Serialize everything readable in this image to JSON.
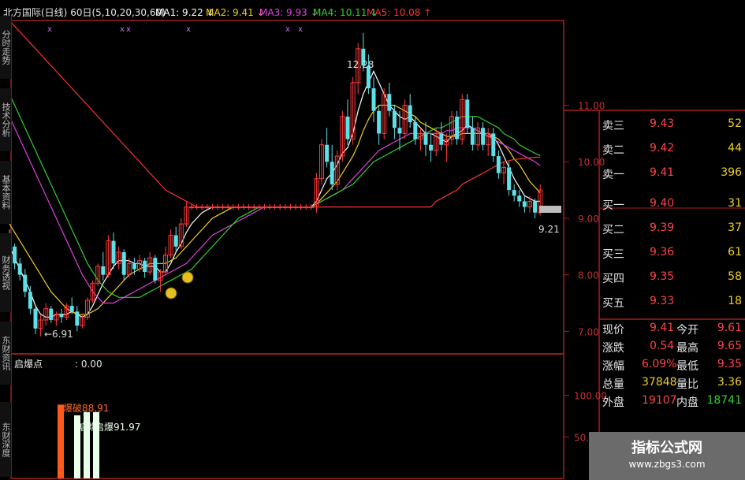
{
  "header": {
    "title": "北方国际(日线)",
    "period": "60日",
    "ma_params": "(5,10,20,30,60)",
    "ma": [
      {
        "label": "MA1:",
        "value": "9.22",
        "arrow": "↓",
        "color": "#ffffff"
      },
      {
        "label": "MA2:",
        "value": "9.41",
        "arrow": "↓",
        "color": "#f0d020"
      },
      {
        "label": "MA3:",
        "value": "9.93",
        "arrow": "↓",
        "color": "#e040e0"
      },
      {
        "label": "MA4:",
        "value": "10.11",
        "arrow": "↓",
        "color": "#30d030"
      },
      {
        "label": "MA5:",
        "value": "10.08",
        "arrow": "↑",
        "color": "#ff3030"
      }
    ],
    "marks": "x"
  },
  "side_tabs": [
    "分时走势",
    "技术分析",
    "基本资料",
    "财务透视",
    "东财资讯",
    "东财深度"
  ],
  "price_chart": {
    "y_ticks": [
      "11.00",
      "10.00",
      "9.00",
      "8.00",
      "7.00"
    ],
    "low_label": "←6.91",
    "high_label": "12.28",
    "last_label": "9.21",
    "colors": {
      "up": "#ff3b3b",
      "down": "#5ee0e8"
    }
  },
  "indicator": {
    "name": "启爆点",
    "value": ": 0.00",
    "y_ticks": [
      "100.00",
      "50.00"
    ],
    "labels": [
      "爆破88.91",
      "启爆",
      "启爆91.97"
    ],
    "bars": [
      {
        "value": 88.91,
        "color": "#ff5a1a"
      },
      {
        "value": 76,
        "color": "#e8ffe8"
      },
      {
        "value": 80,
        "color": "#e8ffe8"
      },
      {
        "value": 80,
        "color": "#e8ffe8"
      }
    ]
  },
  "order_book": [
    {
      "name": "卖三",
      "price": "9.43",
      "vol": "52",
      "pcolor": "#ff4444",
      "vcolor": "#f0d020"
    },
    {
      "name": "卖二",
      "price": "9.42",
      "vol": "44",
      "pcolor": "#ff4444",
      "vcolor": "#f0d020"
    },
    {
      "name": "卖一",
      "price": "9.41",
      "vol": "396",
      "pcolor": "#ff4444",
      "vcolor": "#f0d020"
    },
    {
      "name": "买一",
      "price": "9.40",
      "vol": "31",
      "pcolor": "#ff4444",
      "vcolor": "#f0d020"
    },
    {
      "name": "买二",
      "price": "9.39",
      "vol": "37",
      "pcolor": "#ff4444",
      "vcolor": "#f0d020"
    },
    {
      "name": "买三",
      "price": "9.36",
      "vol": "61",
      "pcolor": "#ff4444",
      "vcolor": "#f0d020"
    },
    {
      "name": "买四",
      "price": "9.35",
      "vol": "58",
      "pcolor": "#ff4444",
      "vcolor": "#f0d020"
    },
    {
      "name": "买五",
      "price": "9.33",
      "vol": "18",
      "pcolor": "#ff4444",
      "vcolor": "#f0d020"
    }
  ],
  "stats": [
    {
      "n1": "现价",
      "v1": "9.41",
      "c1": "#ff4444",
      "n2": "今开",
      "v2": "9.61",
      "c2": "#ff4444"
    },
    {
      "n1": "涨跌",
      "v1": "0.54",
      "c1": "#ff4444",
      "n2": "最高",
      "v2": "9.65",
      "c2": "#ff4444"
    },
    {
      "n1": "涨幅",
      "v1": "6.09%",
      "c1": "#ff4444",
      "n2": "最低",
      "v2": "9.35",
      "c2": "#ff4444"
    },
    {
      "n1": "总量",
      "v1": "37848",
      "c1": "#f0d020",
      "n2": "量比",
      "v2": "3.36",
      "c2": "#f0d020"
    },
    {
      "n1": "外盘",
      "v1": "19107",
      "c1": "#ff4444",
      "n2": "内盘",
      "v2": "18741",
      "c2": "#30d030"
    }
  ],
  "watermark": {
    "title": "指标公式网",
    "url": "www.zbgs3.com"
  },
  "chart_data": {
    "type": "candlestick",
    "title": "北方国际(日线)",
    "ylim": [
      6.6,
      12.5
    ],
    "ohlc": [
      [
        8.7,
        8.8,
        8.4,
        8.5
      ],
      [
        8.5,
        8.55,
        8.1,
        8.2
      ],
      [
        8.2,
        8.3,
        7.9,
        8.0
      ],
      [
        8.0,
        8.1,
        7.6,
        7.7
      ],
      [
        7.7,
        7.8,
        7.3,
        7.4
      ],
      [
        7.4,
        7.45,
        6.95,
        7.05
      ],
      [
        7.05,
        7.3,
        6.91,
        7.2
      ],
      [
        7.2,
        7.5,
        7.1,
        7.4
      ],
      [
        7.4,
        7.45,
        7.15,
        7.2
      ],
      [
        7.2,
        7.35,
        7.1,
        7.3
      ],
      [
        7.3,
        7.4,
        7.15,
        7.25
      ],
      [
        7.25,
        7.5,
        7.2,
        7.45
      ],
      [
        7.45,
        7.6,
        7.3,
        7.35
      ],
      [
        7.35,
        7.45,
        7.0,
        7.1
      ],
      [
        7.1,
        7.3,
        7.05,
        7.25
      ],
      [
        7.25,
        7.6,
        7.2,
        7.55
      ],
      [
        7.55,
        7.9,
        7.5,
        7.85
      ],
      [
        7.85,
        8.2,
        7.8,
        8.15
      ],
      [
        8.15,
        8.4,
        7.9,
        8.0
      ],
      [
        8.0,
        8.7,
        7.95,
        8.6
      ],
      [
        8.6,
        8.75,
        8.1,
        8.2
      ],
      [
        8.2,
        8.5,
        8.1,
        8.4
      ],
      [
        8.4,
        8.45,
        7.9,
        8.0
      ],
      [
        8.0,
        8.3,
        7.95,
        8.2
      ],
      [
        8.2,
        8.3,
        8.0,
        8.1
      ],
      [
        8.1,
        8.35,
        8.05,
        8.25
      ],
      [
        8.25,
        8.3,
        7.95,
        8.05
      ],
      [
        8.05,
        8.4,
        8.0,
        8.3
      ],
      [
        8.3,
        8.35,
        7.85,
        7.9
      ],
      [
        7.9,
        8.1,
        7.7,
        8.05
      ],
      [
        8.05,
        8.5,
        8.0,
        8.35
      ],
      [
        8.35,
        8.8,
        8.3,
        8.7
      ],
      [
        8.7,
        8.85,
        8.4,
        8.5
      ],
      [
        8.5,
        9.0,
        8.45,
        8.9
      ],
      [
        8.9,
        9.3,
        8.85,
        9.2
      ],
      [
        9.2,
        9.25,
        9.15,
        9.2
      ],
      [
        9.2,
        9.25,
        9.15,
        9.2
      ],
      [
        9.2,
        9.25,
        9.15,
        9.2
      ],
      [
        9.2,
        9.25,
        9.15,
        9.2
      ],
      [
        9.2,
        9.25,
        9.15,
        9.2
      ],
      [
        9.2,
        9.25,
        9.15,
        9.2
      ],
      [
        9.2,
        9.25,
        9.15,
        9.2
      ],
      [
        9.2,
        9.25,
        9.15,
        9.2
      ],
      [
        9.2,
        9.25,
        9.15,
        9.2
      ],
      [
        9.2,
        9.25,
        9.15,
        9.2
      ],
      [
        9.2,
        9.25,
        9.15,
        9.2
      ],
      [
        9.2,
        9.25,
        9.15,
        9.2
      ],
      [
        9.2,
        9.25,
        9.15,
        9.2
      ],
      [
        9.2,
        9.25,
        9.15,
        9.2
      ],
      [
        9.2,
        9.25,
        9.15,
        9.2
      ],
      [
        9.2,
        9.25,
        9.15,
        9.2
      ],
      [
        9.2,
        9.25,
        9.15,
        9.2
      ],
      [
        9.2,
        9.25,
        9.15,
        9.2
      ],
      [
        9.2,
        9.25,
        9.15,
        9.2
      ],
      [
        9.2,
        9.25,
        9.15,
        9.2
      ],
      [
        9.2,
        9.25,
        9.15,
        9.2
      ],
      [
        9.2,
        9.25,
        9.15,
        9.2
      ],
      [
        9.2,
        9.25,
        9.15,
        9.2
      ],
      [
        9.2,
        9.25,
        9.15,
        9.2
      ],
      [
        9.2,
        9.8,
        9.1,
        9.7
      ],
      [
        9.7,
        10.4,
        9.6,
        10.3
      ],
      [
        10.3,
        10.6,
        9.9,
        10.0
      ],
      [
        10.0,
        10.3,
        9.5,
        9.6
      ],
      [
        9.6,
        10.2,
        9.5,
        10.1
      ],
      [
        10.1,
        10.9,
        10.0,
        10.8
      ],
      [
        10.8,
        11.1,
        10.3,
        10.4
      ],
      [
        10.4,
        11.5,
        10.3,
        11.4
      ],
      [
        11.4,
        12.1,
        11.2,
        12.0
      ],
      [
        12.0,
        12.28,
        11.6,
        11.7
      ],
      [
        11.7,
        11.9,
        11.2,
        11.3
      ],
      [
        11.3,
        11.5,
        10.7,
        10.9
      ],
      [
        10.9,
        11.0,
        10.3,
        10.5
      ],
      [
        10.5,
        11.3,
        10.4,
        11.2
      ],
      [
        11.2,
        11.4,
        10.8,
        10.9
      ],
      [
        10.9,
        11.0,
        10.4,
        10.6
      ],
      [
        10.6,
        10.9,
        10.2,
        10.5
      ],
      [
        10.5,
        11.1,
        10.4,
        11.0
      ],
      [
        11.0,
        11.2,
        10.6,
        10.7
      ],
      [
        10.7,
        10.8,
        10.3,
        10.4
      ],
      [
        10.4,
        10.6,
        10.2,
        10.5
      ],
      [
        10.5,
        10.7,
        10.1,
        10.3
      ],
      [
        10.3,
        10.5,
        10.0,
        10.2
      ],
      [
        10.2,
        10.6,
        10.1,
        10.5
      ],
      [
        10.5,
        10.7,
        10.2,
        10.3
      ],
      [
        10.3,
        10.5,
        10.0,
        10.4
      ],
      [
        10.4,
        10.9,
        10.3,
        10.8
      ],
      [
        10.8,
        10.9,
        10.3,
        10.4
      ],
      [
        10.4,
        11.2,
        10.3,
        11.1
      ],
      [
        11.1,
        11.2,
        10.5,
        10.6
      ],
      [
        10.6,
        10.8,
        10.2,
        10.3
      ],
      [
        10.3,
        10.7,
        10.2,
        10.6
      ],
      [
        10.6,
        10.7,
        10.2,
        10.3
      ],
      [
        10.3,
        10.6,
        10.1,
        10.5
      ],
      [
        10.5,
        10.6,
        10.0,
        10.1
      ],
      [
        10.1,
        10.2,
        9.7,
        9.8
      ],
      [
        9.8,
        10.0,
        9.6,
        9.9
      ],
      [
        9.9,
        10.0,
        9.4,
        9.5
      ],
      [
        9.5,
        9.6,
        9.3,
        9.4
      ],
      [
        9.4,
        9.5,
        9.2,
        9.3
      ],
      [
        9.3,
        9.4,
        9.1,
        9.2
      ],
      [
        9.2,
        9.4,
        9.1,
        9.3
      ],
      [
        9.3,
        9.35,
        9.0,
        9.1
      ],
      [
        9.1,
        9.6,
        9.05,
        9.5
      ]
    ],
    "series": [
      {
        "name": "MA1",
        "values": [
          8.5,
          8.3,
          8.1,
          7.9,
          7.7,
          7.45,
          7.3,
          7.25,
          7.25,
          7.3,
          7.3,
          7.3,
          7.35,
          7.3,
          7.25,
          7.3,
          7.45,
          7.65,
          7.85,
          8.0,
          8.15,
          8.25,
          8.25,
          8.25,
          8.2,
          8.2,
          8.15,
          8.15,
          8.15,
          8.05,
          8.05,
          8.2,
          8.4,
          8.55,
          8.75,
          8.9,
          9.0,
          9.1,
          9.15,
          9.2,
          9.2,
          9.2,
          9.2,
          9.2,
          9.2,
          9.2,
          9.2,
          9.2,
          9.2,
          9.2,
          9.2,
          9.2,
          9.2,
          9.2,
          9.2,
          9.2,
          9.2,
          9.2,
          9.2,
          9.3,
          9.5,
          9.7,
          9.8,
          9.95,
          10.15,
          10.25,
          10.5,
          10.9,
          11.2,
          11.4,
          11.6,
          11.4,
          11.2,
          11.0,
          10.9,
          10.8,
          10.75,
          10.8,
          10.7,
          10.6,
          10.5,
          10.5,
          10.45,
          10.4,
          10.35,
          10.45,
          10.5,
          10.55,
          10.65,
          10.6,
          10.55,
          10.5,
          10.45,
          10.45,
          10.3,
          10.1,
          9.9,
          9.7,
          9.55,
          9.4,
          9.35,
          9.3,
          9.3
        ]
      },
      {
        "name": "MA2",
        "values": [
          8.9,
          8.75,
          8.6,
          8.45,
          8.3,
          8.15,
          8.0,
          7.85,
          7.7,
          7.6,
          7.5,
          7.4,
          7.35,
          7.3,
          7.3,
          7.3,
          7.35,
          7.4,
          7.5,
          7.6,
          7.7,
          7.8,
          7.9,
          8.0,
          8.05,
          8.1,
          8.15,
          8.2,
          8.2,
          8.2,
          8.2,
          8.25,
          8.3,
          8.4,
          8.5,
          8.6,
          8.7,
          8.8,
          8.9,
          9.0,
          9.05,
          9.1,
          9.15,
          9.2,
          9.2,
          9.2,
          9.2,
          9.2,
          9.2,
          9.2,
          9.2,
          9.2,
          9.2,
          9.2,
          9.2,
          9.2,
          9.2,
          9.2,
          9.2,
          9.25,
          9.35,
          9.45,
          9.55,
          9.65,
          9.8,
          9.95,
          10.1,
          10.3,
          10.55,
          10.75,
          10.9,
          11.0,
          11.0,
          11.0,
          11.0,
          10.95,
          10.9,
          10.85,
          10.8,
          10.7,
          10.65,
          10.6,
          10.55,
          10.5,
          10.45,
          10.45,
          10.45,
          10.5,
          10.5,
          10.5,
          10.5,
          10.5,
          10.5,
          10.45,
          10.4,
          10.3,
          10.2,
          10.05,
          9.95,
          9.8,
          9.65,
          9.55,
          9.45
        ]
      },
      {
        "name": "MA3",
        "values": [
          10.8,
          10.6,
          10.4,
          10.2,
          10.0,
          9.8,
          9.6,
          9.4,
          9.2,
          9.0,
          8.8,
          8.6,
          8.4,
          8.2,
          8.0,
          7.85,
          7.7,
          7.6,
          7.5,
          7.5,
          7.5,
          7.55,
          7.6,
          7.65,
          7.7,
          7.75,
          7.8,
          7.85,
          7.9,
          7.95,
          8.0,
          8.05,
          8.1,
          8.15,
          8.2,
          8.3,
          8.4,
          8.5,
          8.6,
          8.7,
          8.75,
          8.8,
          8.85,
          8.9,
          8.95,
          9.0,
          9.05,
          9.1,
          9.15,
          9.2,
          9.2,
          9.2,
          9.2,
          9.2,
          9.2,
          9.2,
          9.2,
          9.2,
          9.2,
          9.25,
          9.3,
          9.35,
          9.4,
          9.45,
          9.5,
          9.6,
          9.7,
          9.8,
          9.9,
          10.0,
          10.1,
          10.2,
          10.25,
          10.3,
          10.35,
          10.4,
          10.45,
          10.5,
          10.5,
          10.5,
          10.5,
          10.5,
          10.5,
          10.5,
          10.55,
          10.55,
          10.6,
          10.6,
          10.6,
          10.6,
          10.55,
          10.5,
          10.45,
          10.4,
          10.35,
          10.3,
          10.25,
          10.2,
          10.15,
          10.1,
          10.05,
          10.0,
          9.93
        ]
      },
      {
        "name": "MA4",
        "values": [
          11.2,
          11.0,
          10.8,
          10.6,
          10.4,
          10.2,
          10.0,
          9.8,
          9.6,
          9.4,
          9.2,
          9.0,
          8.8,
          8.6,
          8.4,
          8.2,
          8.05,
          7.9,
          7.8,
          7.7,
          7.65,
          7.6,
          7.6,
          7.6,
          7.6,
          7.6,
          7.65,
          7.7,
          7.75,
          7.8,
          7.85,
          7.9,
          7.95,
          8.0,
          8.05,
          8.1,
          8.2,
          8.3,
          8.4,
          8.5,
          8.6,
          8.7,
          8.8,
          8.9,
          9.0,
          9.05,
          9.1,
          9.15,
          9.2,
          9.2,
          9.2,
          9.2,
          9.2,
          9.2,
          9.2,
          9.2,
          9.2,
          9.2,
          9.2,
          9.25,
          9.3,
          9.35,
          9.4,
          9.45,
          9.5,
          9.55,
          9.6,
          9.7,
          9.8,
          9.9,
          10.0,
          10.05,
          10.1,
          10.15,
          10.2,
          10.25,
          10.3,
          10.35,
          10.4,
          10.45,
          10.5,
          10.55,
          10.6,
          10.6,
          10.65,
          10.7,
          10.75,
          10.8,
          10.8,
          10.8,
          10.8,
          10.75,
          10.7,
          10.65,
          10.6,
          10.5,
          10.45,
          10.4,
          10.3,
          10.25,
          10.2,
          10.15,
          10.11
        ]
      },
      {
        "name": "MA5",
        "values": [
          12.5,
          12.4,
          12.3,
          12.2,
          12.1,
          12.0,
          11.9,
          11.8,
          11.7,
          11.6,
          11.5,
          11.4,
          11.3,
          11.2,
          11.1,
          11.0,
          10.9,
          10.8,
          10.7,
          10.6,
          10.5,
          10.4,
          10.3,
          10.2,
          10.1,
          10.0,
          9.9,
          9.8,
          9.7,
          9.6,
          9.5,
          9.45,
          9.4,
          9.35,
          9.3,
          9.25,
          9.2,
          9.2,
          9.2,
          9.2,
          9.2,
          9.2,
          9.2,
          9.2,
          9.2,
          9.2,
          9.2,
          9.2,
          9.2,
          9.2,
          9.2,
          9.2,
          9.2,
          9.2,
          9.2,
          9.2,
          9.2,
          9.2,
          9.2,
          9.2,
          9.2,
          9.2,
          9.2,
          9.2,
          9.2,
          9.2,
          9.2,
          9.2,
          9.2,
          9.2,
          9.2,
          9.2,
          9.2,
          9.2,
          9.2,
          9.2,
          9.2,
          9.2,
          9.2,
          9.2,
          9.2,
          9.2,
          9.3,
          9.35,
          9.4,
          9.45,
          9.5,
          9.6,
          9.65,
          9.7,
          9.75,
          9.8,
          9.85,
          9.9,
          9.95,
          10.0,
          10.02,
          10.04,
          10.05,
          10.06,
          10.07,
          10.08,
          10.08
        ]
      }
    ]
  }
}
